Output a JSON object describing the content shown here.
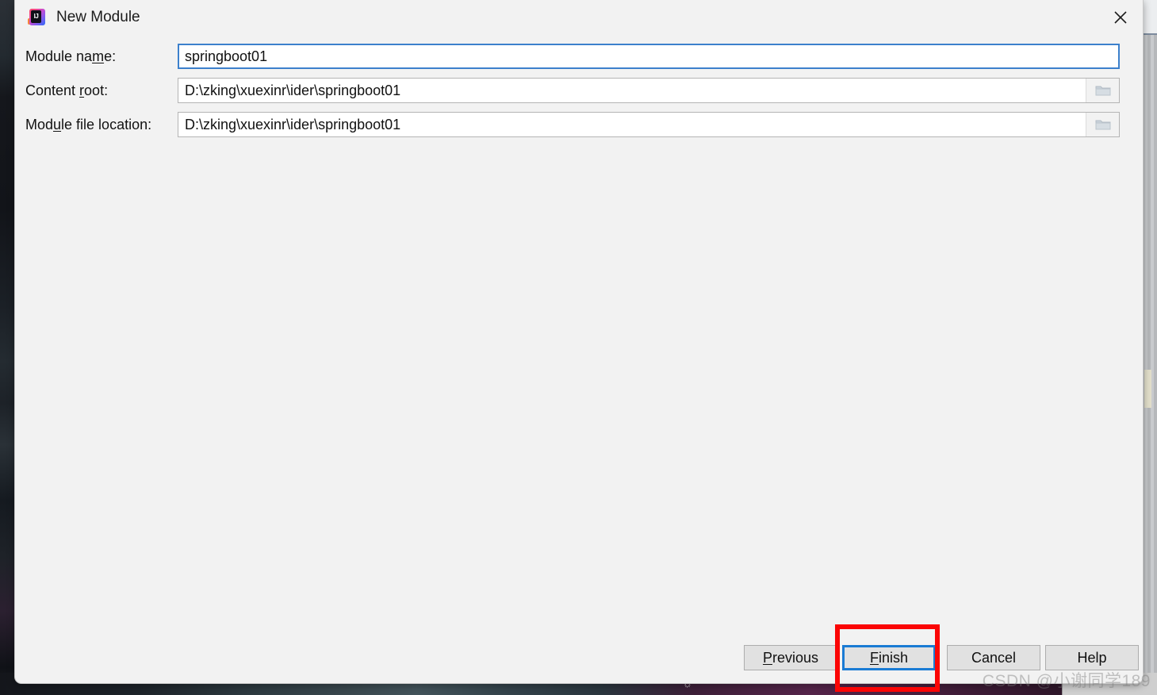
{
  "dialog": {
    "title": "New Module",
    "app_icon": "intellij-idea-logo",
    "close_icon": "close-icon",
    "background_color": "#f2f2f2"
  },
  "form": {
    "fields": [
      {
        "label_before": "Module na",
        "label_mnemonic": "m",
        "label_after": "e:",
        "value": "springboot01",
        "focused": true,
        "has_browse": false
      },
      {
        "label_before": "Content ",
        "label_mnemonic": "r",
        "label_after": "oot:",
        "value": "D:\\zking\\xuexinr\\ider\\springboot01",
        "focused": false,
        "has_browse": true,
        "browse_icon": "folder-icon"
      },
      {
        "label_before": "Mod",
        "label_mnemonic": "u",
        "label_after": "le file location:",
        "value": "D:\\zking\\xuexinr\\ider\\springboot01",
        "focused": false,
        "has_browse": true,
        "browse_icon": "folder-icon"
      }
    ]
  },
  "footer": {
    "buttons": [
      {
        "before": "",
        "mnemonic": "P",
        "after": "revious",
        "focused": false
      },
      {
        "before": "",
        "mnemonic": "F",
        "after": "inish",
        "focused": true
      },
      {
        "before": "Cancel",
        "mnemonic": "",
        "after": "",
        "focused": false
      },
      {
        "before": "Help",
        "mnemonic": "",
        "after": "",
        "focused": false
      }
    ]
  },
  "annotation": {
    "shape": "rectangle",
    "color": "#fb0505",
    "target": "finish-button"
  },
  "watermark": {
    "text": "CSDN @小谢同学189"
  },
  "colors": {
    "focus_blue": "#1a7bd4",
    "field_focus_blue": "#3c80cc",
    "annotation_red": "#fb0505",
    "dialog_bg": "#f2f2f2",
    "button_bg": "#e1e1e1"
  }
}
